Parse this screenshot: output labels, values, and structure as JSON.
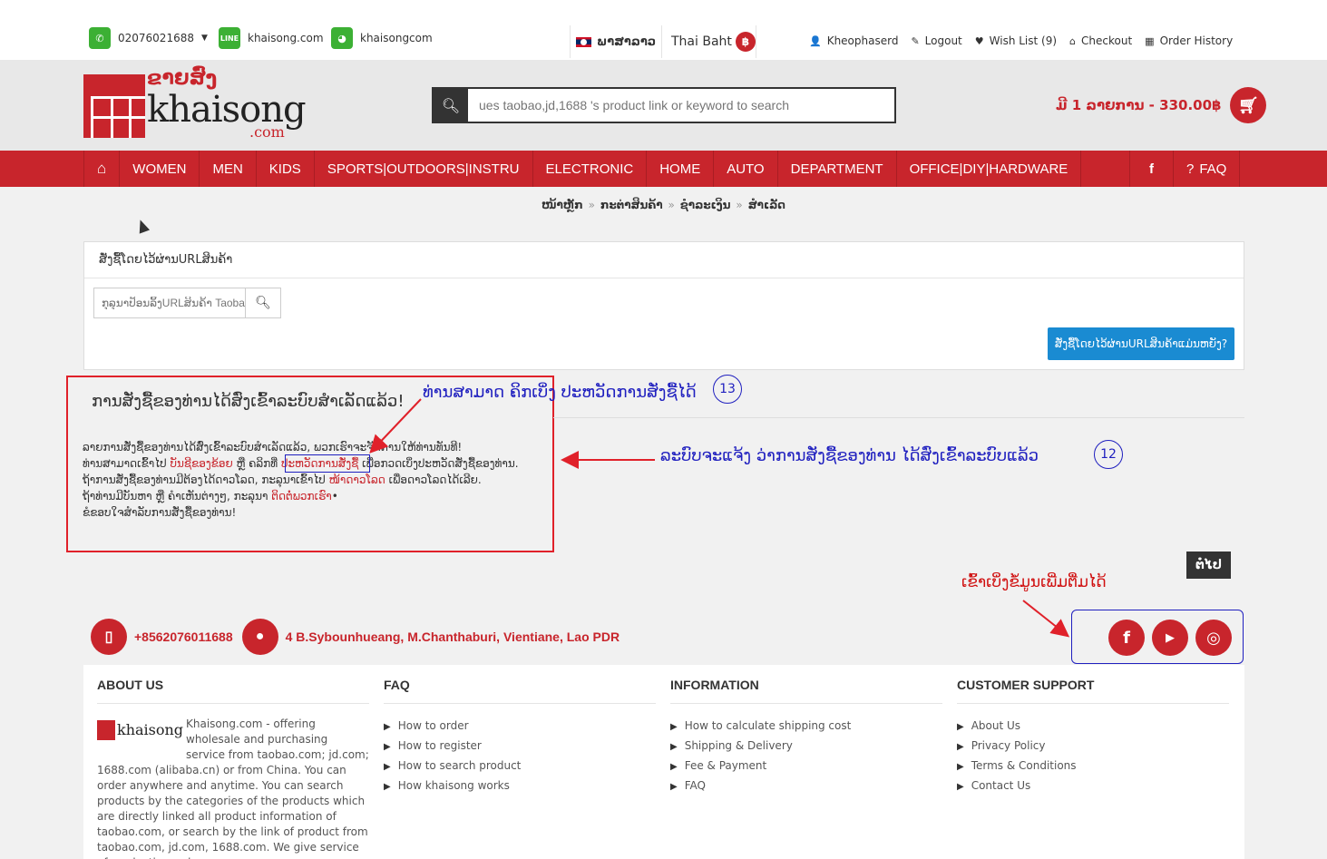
{
  "topbar": {
    "phone": "02076021688",
    "line": "khaisong.com",
    "wechat": "khaisongcom",
    "language": "ພາສາລາວ",
    "currency": "Thai Baht",
    "currency_symbol": "฿",
    "user": "Kheophaserd",
    "logout": "Logout",
    "wishlist": "Wish List (9)",
    "checkout": "Checkout",
    "order_history": "Order History"
  },
  "header": {
    "logo_lao": "ຂາຍສົ່ງ",
    "logo_text": "khaisong",
    "logo_com": ".com",
    "search_placeholder": "ues taobao,jd,1688 's product link or keyword to search",
    "cart_text": "ມີ 1 ລາຍການ - 330.00฿"
  },
  "nav": {
    "items": [
      "WOMEN",
      "MEN",
      "KIDS",
      "SPORTS|OUTDOORS|INSTRU",
      "ELECTRONIC",
      "HOME",
      "AUTO",
      "DEPARTMENT",
      "OFFICE|DIY|HARDWARE"
    ],
    "faq": "FAQ"
  },
  "breadcrumb": [
    "ໜ້າຫຼັກ",
    "ກະຕ່າສິນຄ້າ",
    "ຊຳລະເງິນ",
    "ສຳເລັດ"
  ],
  "url_panel": {
    "title": "ສັ່ງຊື້ໂດຍໄວ້ຜ່ານURLສິນຄ້າ",
    "input_placeholder": "ກຸລຸນາປ້ອນລິ້ງURLສິນຄ້າ Taobao",
    "how_button": "ສັ່ງຊື້ໂດຍໄວ້ຜ່ານURLສິນຄ້າແມ່ນຫຍັງ?"
  },
  "success": {
    "title": "ການສັ່ງຊື້ຂອງທ່ານໄດ້ສົ່ງເຂົ້າລະບົບສຳເລັດແລ້ວ!",
    "line1": "ລາຍການສັ່ງຊື້ຂອງທ່ານໄດ້ສົ່ງເຂົ້າລະບົບສຳເລັດແລ້ວ, ພວກເຮົາຈະຈັດການໃຫ້ທ່ານທັນທີ!",
    "line2_a": "ທ່ານສາມາດເຂົ້າໄປ ",
    "line2_link1": "ບັນຊີຂອງຂ້ອຍ",
    "line2_b": " ຫຼື ຄລິກທີ່ ",
    "line2_link2": "ປະຫວັດການສັ່ງຊື້",
    "line2_c": " ເພື່ອກວດເບິ່ງປະຫວັດສັ່ງຊື້ຂອງທ່ານ.",
    "line3_a": "ຖ້າການສັ່ງຊື້ຂອງທ່ານມີຕ້ອງໄດ້ດາວໂລດ, ກະລຸນາເຂົ້າໄປ ",
    "line3_link": "ໜ້າດາວໂລດ",
    "line3_b": " ເພື່ອດາວໂລດໄດ້ເລີຍ.",
    "line4_a": "ຖ້າທ່ານມີບັນຫາ ຫຼື ຄຳເຫັນຕ່າງໆ, ກະລຸນາ ",
    "line4_link": "ຕິດຕໍ່ພວກເຮົາ",
    "line4_b": "•",
    "line5": "ຂໍຂອບໃຈສຳລັບການສັ່ງຊື້ຂອງທ່ານ!"
  },
  "annotations": {
    "a13_text": "ທ່ານສາມາດ ຄິກເບິ່ງ ປະຫວັດການສັ່ງຊື້ໄດ້",
    "a13_num": "13",
    "a12_text": "ລະບົບຈະແຈ້ງ ວ່າການສັ່ງຊື້ຂອງທ່ານ ໄດ້ສົ່ງເຂົ້າລະບົບແລ້ວ",
    "a12_num": "12",
    "social_note": "ເຂົ້າເບິ່ງຂໍ້ມູນເພີ່ມຕື່ມໄດ້"
  },
  "next_button": "ຕໍ່ໄປ",
  "contact": {
    "phone": "+8562076011688",
    "address": "4 B.Sybounhueang, M.Chanthaburi, Vientiane, Lao PDR"
  },
  "footer": {
    "about_title": "ABOUT US",
    "about_text": "Khaisong.com - offering wholesale and purchasing service from taobao.com; jd.com; 1688.com (alibaba.cn) or from China. You can order anywhere and anytime. You can search products by the categories of the products which are directly linked all product information of taobao.com, or search by the link of product from taobao.com, jd.com, 1688.com. We give service of production order,",
    "faq_title": "FAQ",
    "faq_items": [
      "How to order",
      "How to register",
      "How to search product",
      "How khaisong works"
    ],
    "info_title": "INFORMATION",
    "info_items": [
      "How to calculate shipping cost",
      "Shipping & Delivery",
      "Fee & Payment",
      "FAQ"
    ],
    "support_title": "CUSTOMER SUPPORT",
    "support_items": [
      "About Us",
      "Privacy Policy",
      "Terms & Conditions",
      "Contact Us"
    ]
  },
  "colors": {
    "brand_red": "#c8252c",
    "annotation_blue": "#1f1fbf",
    "annotation_red": "#e0212a",
    "button_blue": "#1a8bd2"
  }
}
